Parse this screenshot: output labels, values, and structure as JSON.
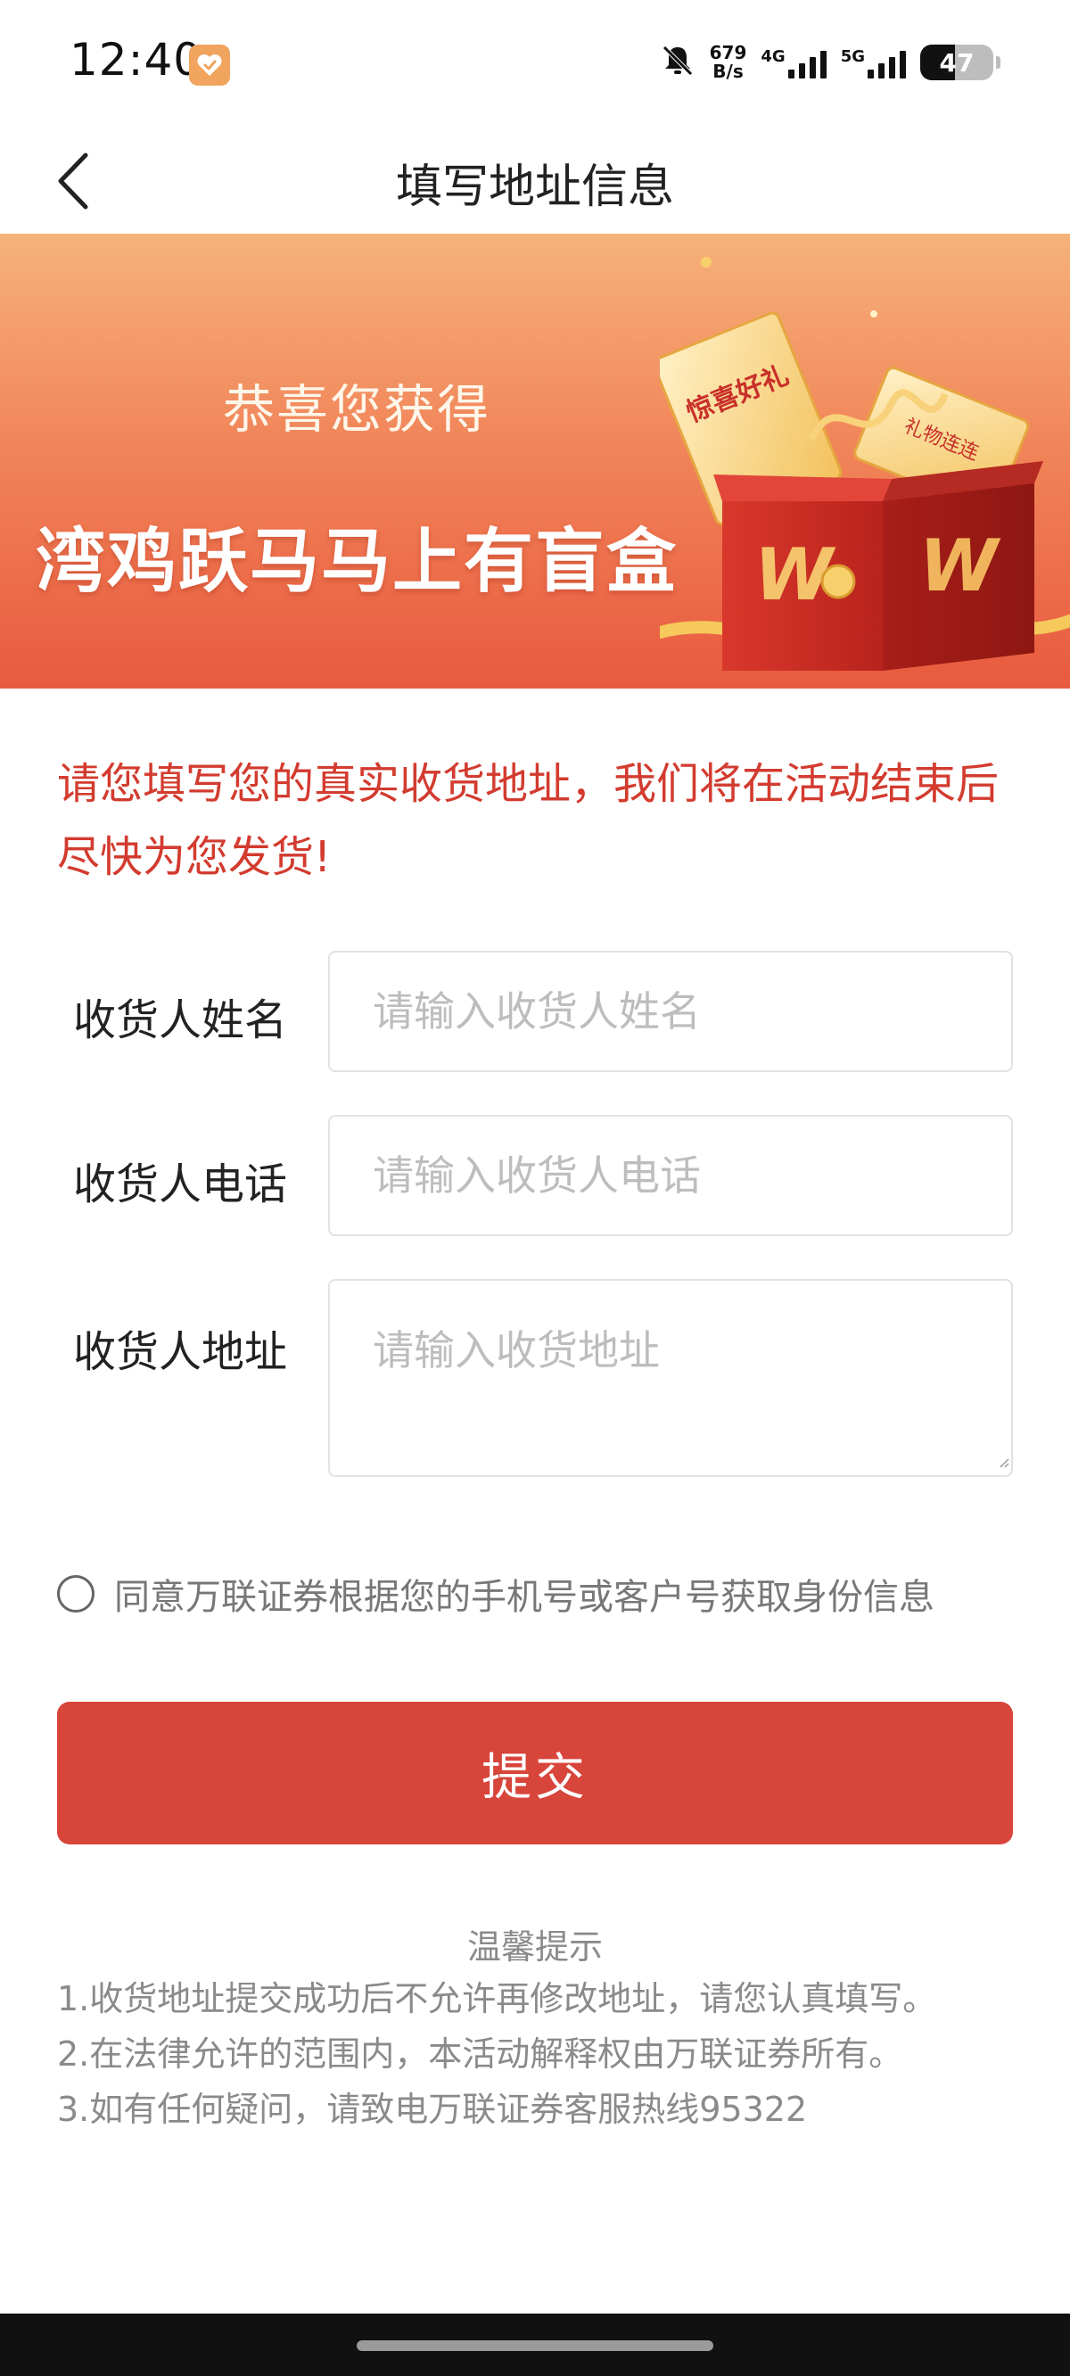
{
  "status_bar": {
    "time": "12:40",
    "net_speed_value": "679",
    "net_speed_unit": "B/s",
    "net_type_1": "4G",
    "net_type_2": "5G",
    "battery": "47",
    "battery_level": 0.47
  },
  "header": {
    "title": "填写地址信息"
  },
  "banner": {
    "subtitle": "恭喜您获得",
    "title": "湾鸡跃马马上有盲盒",
    "ticket_text_1": "惊喜好礼",
    "ticket_text_2": "礼物连连"
  },
  "notice": {
    "text": "请您填写您的真实收货地址，我们将在活动结束后尽快为您发货!"
  },
  "form": {
    "name": {
      "label": "收货人姓名",
      "placeholder": "请输入收货人姓名",
      "value": ""
    },
    "phone": {
      "label": "收货人电话",
      "placeholder": "请输入收货人电话",
      "value": ""
    },
    "address": {
      "label": "收货人地址",
      "placeholder": "请输入收货地址",
      "value": ""
    }
  },
  "agreement": {
    "text": "同意万联证券根据您的手机号或客户号获取身份信息",
    "checked": false
  },
  "submit": {
    "label": "提交"
  },
  "tips": {
    "title": "温馨提示",
    "items": [
      "1.收货地址提交成功后不允许再修改地址，请您认真填写。",
      "2.在法律允许的范围内，本活动解释权由万联证券所有。",
      "3.如有任何疑问，请致电万联证券客服热线95322"
    ]
  },
  "colors": {
    "accent_red": "#d8453b",
    "notice_red": "#d33b2f",
    "banner_top": "#f6b27a",
    "banner_bottom": "#e85a3e"
  }
}
